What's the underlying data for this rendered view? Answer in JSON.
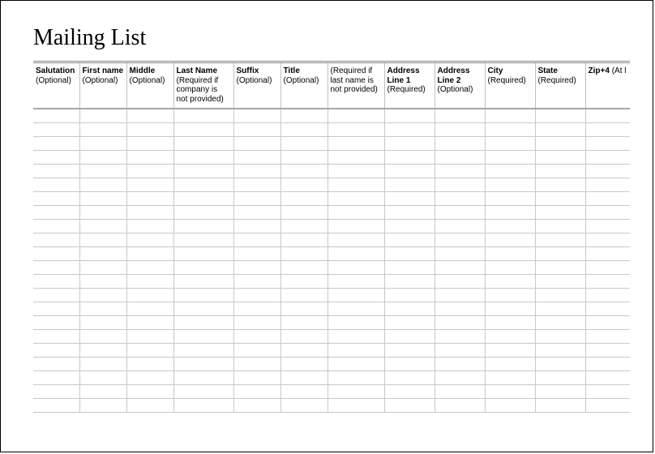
{
  "title": "Mailing List",
  "columns": [
    {
      "label": "Salutation",
      "note": "(Optional)"
    },
    {
      "label": "First name",
      "note": "(Optional)"
    },
    {
      "label": "Middle",
      "note": "(Optional)"
    },
    {
      "label": "Last Name",
      "note": "(Required if company is not provided)"
    },
    {
      "label": "Suffix",
      "note": "(Optional)"
    },
    {
      "label": "Title",
      "note": "(Optional)"
    },
    {
      "label": "",
      "note": "(Required if last name is not provided)"
    },
    {
      "label": "Address Line 1",
      "note": "(Required)"
    },
    {
      "label": "Address Line 2",
      "note": "(Optional)"
    },
    {
      "label": "City",
      "note": "(Required)"
    },
    {
      "label": "State",
      "note": "(Required)"
    },
    {
      "label": "Zip+4",
      "note": "(At l"
    }
  ],
  "row_count": 22
}
